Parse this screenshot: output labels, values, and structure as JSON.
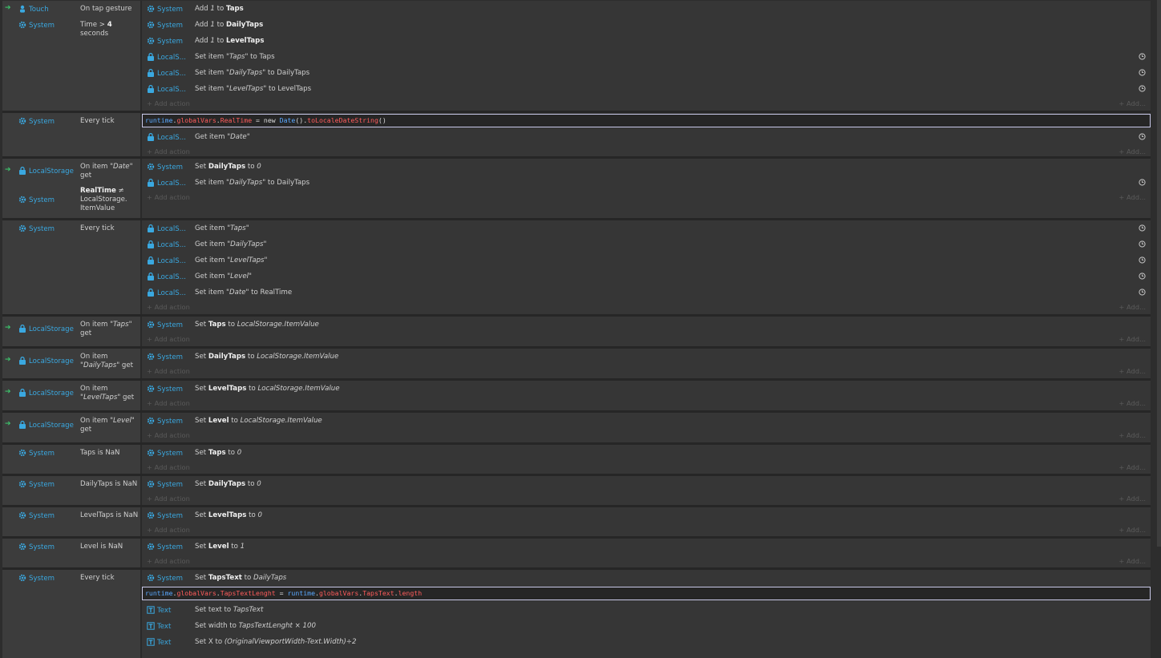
{
  "e1": {
    "c1_obj": "Touch",
    "c1_txt": "On tap gesture",
    "c2_obj": "System",
    "c2_a": "Time > ",
    "c2_b": "4",
    "c2_c": " seconds",
    "a1_obj": "System",
    "a1_a": "Add ",
    "a1_b": "1",
    "a1_c": " to ",
    "a1_d": "Taps",
    "a2_obj": "System",
    "a2_a": "Add ",
    "a2_b": "1",
    "a2_c": " to ",
    "a2_d": "DailyTaps",
    "a3_obj": "System",
    "a3_a": "Add ",
    "a3_b": "1",
    "a3_c": " to ",
    "a3_d": "LevelTaps",
    "a4_obj": "LocalS...",
    "a4_a": "Set item ",
    "a4_b": "\"Taps\"",
    "a4_c": " to Taps",
    "a5_obj": "LocalS...",
    "a5_a": "Set item ",
    "a5_b": "\"DailyTaps\"",
    "a5_c": " to DailyTaps",
    "a6_obj": "LocalS...",
    "a6_a": "Set item ",
    "a6_b": "\"LevelTaps\"",
    "a6_c": " to LevelTaps"
  },
  "e2": {
    "c1_obj": "System",
    "c1_txt": "Every tick",
    "s_a": "runtime",
    "s_b": ".",
    "s_c": "globalVars",
    "s_d": ".",
    "s_e": "RealTime",
    "s_f": " = new ",
    "s_g": "Date",
    "s_h": "().",
    "s_i": "toLocaleDateString",
    "s_j": "()",
    "a1_obj": "LocalS...",
    "a1_a": "Get item ",
    "a1_b": "\"Date\""
  },
  "e3": {
    "c1_obj": "LocalStorage",
    "c1_a": "On item ",
    "c1_b": "\"Date\"",
    "c1_c": " get",
    "c2_obj": "System",
    "c2_a": "RealTime",
    "c2_b": " ≠ LocalStorage. ItemValue",
    "a1_obj": "System",
    "a1_a": "Set ",
    "a1_b": "DailyTaps",
    "a1_c": " to ",
    "a1_d": "0",
    "a2_obj": "LocalS...",
    "a2_a": "Set item ",
    "a2_b": "\"DailyTaps\"",
    "a2_c": " to DailyTaps"
  },
  "e4": {
    "c1_obj": "System",
    "c1_txt": "Every tick",
    "a1_obj": "LocalS...",
    "a1_a": "Get item ",
    "a1_b": "\"Taps\"",
    "a2_obj": "LocalS...",
    "a2_a": "Get item ",
    "a2_b": "\"DailyTaps\"",
    "a3_obj": "LocalS...",
    "a3_a": "Get item ",
    "a3_b": "\"LevelTaps\"",
    "a4_obj": "LocalS...",
    "a4_a": "Get item ",
    "a4_b": "\"Level\"",
    "a5_obj": "LocalS...",
    "a5_a": "Set item ",
    "a5_b": "\"Date\"",
    "a5_c": " to RealTime"
  },
  "e5": {
    "c1_obj": "LocalStorage",
    "c1_a": "On item ",
    "c1_b": "\"Taps\"",
    "c1_c": " get",
    "a1_obj": "System",
    "a1_a": "Set ",
    "a1_b": "Taps",
    "a1_c": " to ",
    "a1_d": "LocalStorage.ItemValue"
  },
  "e6": {
    "c1_obj": "LocalStorage",
    "c1_a": "On item ",
    "c1_b": "\"DailyTaps\"",
    "c1_c": " get",
    "a1_obj": "System",
    "a1_a": "Set ",
    "a1_b": "DailyTaps",
    "a1_c": " to ",
    "a1_d": "LocalStorage.ItemValue"
  },
  "e7": {
    "c1_obj": "LocalStorage",
    "c1_a": "On item ",
    "c1_b": "\"LevelTaps\"",
    "c1_c": " get",
    "a1_obj": "System",
    "a1_a": "Set ",
    "a1_b": "LevelTaps",
    "a1_c": " to ",
    "a1_d": "LocalStorage.ItemValue"
  },
  "e8": {
    "c1_obj": "LocalStorage",
    "c1_a": "On item ",
    "c1_b": "\"Level\"",
    "c1_c": " get",
    "a1_obj": "System",
    "a1_a": "Set ",
    "a1_b": "Level",
    "a1_c": " to ",
    "a1_d": "LocalStorage.ItemValue"
  },
  "e9": {
    "c1_obj": "System",
    "c1_txt": "Taps is NaN",
    "a1_obj": "System",
    "a1_a": "Set ",
    "a1_b": "Taps",
    "a1_c": " to ",
    "a1_d": "0"
  },
  "e10": {
    "c1_obj": "System",
    "c1_txt": "DailyTaps is NaN",
    "a1_obj": "System",
    "a1_a": "Set ",
    "a1_b": "DailyTaps",
    "a1_c": " to ",
    "a1_d": "0"
  },
  "e11": {
    "c1_obj": "System",
    "c1_txt": "LevelTaps is NaN",
    "a1_obj": "System",
    "a1_a": "Set ",
    "a1_b": "LevelTaps",
    "a1_c": " to ",
    "a1_d": "0"
  },
  "e12": {
    "c1_obj": "System",
    "c1_txt": "Level is NaN",
    "a1_obj": "System",
    "a1_a": "Set ",
    "a1_b": "Level",
    "a1_c": " to ",
    "a1_d": "1"
  },
  "e13": {
    "c1_obj": "System",
    "c1_txt": "Every tick",
    "a1_obj": "System",
    "a1_a": "Set ",
    "a1_b": "TapsText",
    "a1_c": " to ",
    "a1_d": "DailyTaps",
    "s_a": "runtime",
    "s_b": ".",
    "s_c": "globalVars",
    "s_d": ".",
    "s_e": "TapsTextLenght",
    "s_f": " = ",
    "s_g": "runtime",
    "s_h": ".",
    "s_i": "globalVars",
    "s_j": ".",
    "s_k": "TapsText",
    "s_l": ".",
    "s_m": "length",
    "a2_obj": "Text",
    "a2_a": "Set text to ",
    "a2_b": "TapsText",
    "a3_obj": "Text",
    "a3_a": "Set width to ",
    "a3_b": "TapsTextLenght × 100",
    "a4_obj": "Text",
    "a4_a": "Set X to ",
    "a4_b": "(OriginalViewportWidth-Text.Width)÷2"
  },
  "common": {
    "add_action": "+ Add action",
    "add_more": "+ Add..."
  },
  "colors": {
    "object": "#3aa8e0",
    "trigger": "#3cc06a",
    "keyword": "#5aa8ff",
    "property": "#ff5c5c"
  },
  "icons": {
    "system": "gear-icon",
    "touch": "touch-icon",
    "localstorage": "localstorage-icon",
    "text": "text-object-icon",
    "trigger": "trigger-arrow-icon",
    "action_extra": "clock-icon"
  }
}
